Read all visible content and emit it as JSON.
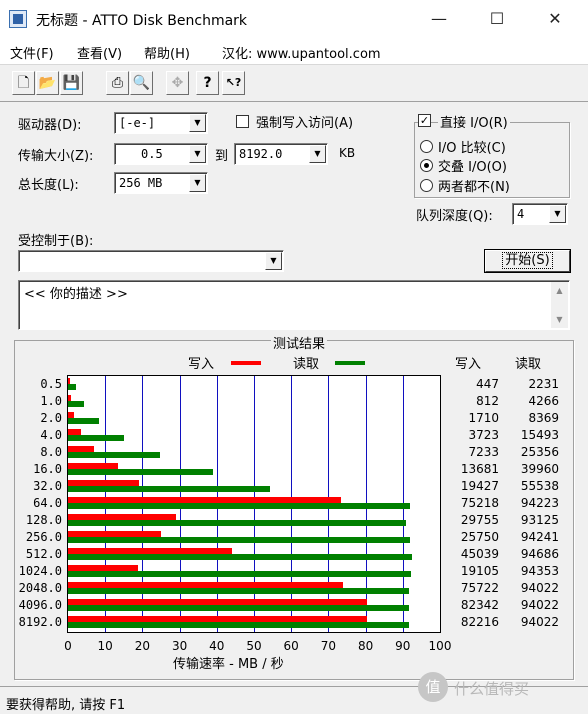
{
  "window": {
    "title": "无标题 - ATTO Disk Benchmark",
    "minimize_glyph": "—",
    "maximize_glyph": "☐",
    "close_glyph": "✕"
  },
  "menu": {
    "items": [
      "文件(F)",
      "查看(V)",
      "帮助(H)"
    ],
    "note": "汉化: www.upantool.com"
  },
  "toolbar": {
    "buttons": [
      {
        "icon": "new-file-icon",
        "glyph": "🗋"
      },
      {
        "icon": "open-folder-icon",
        "glyph": "📂"
      },
      {
        "icon": "save-icon",
        "glyph": "💾"
      },
      {
        "icon": "print-icon",
        "glyph": "⎙"
      },
      {
        "icon": "print-preview-icon",
        "glyph": "🔍"
      },
      {
        "icon": "move-icon",
        "glyph": "✥"
      },
      {
        "icon": "help-icon",
        "glyph": "?"
      },
      {
        "icon": "context-help-icon",
        "glyph": "↖?"
      }
    ]
  },
  "form": {
    "drive_label": "驱动器(D):",
    "drive_value": "[-e-]",
    "force_write_label": "强制写入访问(A)",
    "transfer_size_label": "传输大小(Z):",
    "transfer_from": "0.5",
    "to_label": "到",
    "transfer_to": "8192.0",
    "kb_label": "KB",
    "total_length_label": "总长度(L):",
    "total_length_value": "256 MB",
    "direct_io_label": "直接 I/O(R)",
    "direct_io_checked": "✓",
    "io_compare_label": "I/O 比较(C)",
    "overlapped_io_label": "交叠 I/O(O)",
    "neither_label": "两者都不(N)",
    "queue_depth_label": "队列深度(Q):",
    "queue_depth_value": "4",
    "controlled_by_label": "受控制于(B):",
    "controlled_by_value": "",
    "start_button": "开始(S)",
    "description": "<<  你的描述  >>"
  },
  "results": {
    "title": "测试结果",
    "legend_write": "写入",
    "legend_read": "读取",
    "col_write": "写入",
    "col_read": "读取",
    "write_color": "#ff0000",
    "read_color": "#008000"
  },
  "chart_data": {
    "type": "bar",
    "orientation": "horizontal",
    "title": "测试结果",
    "xlabel": "传输速率 - MB / 秒",
    "xlim": [
      0,
      100
    ],
    "xticks": [
      "0",
      "10",
      "20",
      "30",
      "40",
      "50",
      "60",
      "70",
      "80",
      "90",
      "100"
    ],
    "grid": true,
    "categories": [
      "0.5",
      "1.0",
      "2.0",
      "4.0",
      "8.0",
      "16.0",
      "32.0",
      "64.0",
      "128.0",
      "256.0",
      "512.0",
      "1024.0",
      "2048.0",
      "4096.0",
      "8192.0"
    ],
    "series": [
      {
        "name": "写入",
        "color": "#ff0000",
        "values": [
          0.4,
          0.8,
          1.7,
          3.6,
          7.1,
          13.4,
          19.0,
          73.5,
          29.1,
          25.1,
          44.0,
          18.7,
          73.9,
          80.4,
          80.3
        ]
      },
      {
        "name": "读取",
        "color": "#008000",
        "values": [
          2.2,
          4.2,
          8.2,
          15.1,
          24.8,
          39.0,
          54.2,
          92.0,
          90.9,
          92.0,
          92.5,
          92.1,
          91.8,
          91.8,
          91.8
        ]
      }
    ],
    "table": {
      "write": [
        "447",
        "812",
        "1710",
        "3723",
        "7233",
        "13681",
        "19427",
        "75218",
        "29755",
        "25750",
        "45039",
        "19105",
        "75722",
        "82342",
        "82216"
      ],
      "read": [
        "2231",
        "4266",
        "8369",
        "15493",
        "25356",
        "39960",
        "55538",
        "94223",
        "93125",
        "94241",
        "94686",
        "94353",
        "94022",
        "94022",
        "94022"
      ]
    }
  },
  "status": {
    "text": "要获得帮助, 请按 F1"
  },
  "watermark": {
    "logo_glyph": "值",
    "text": "什么值得买"
  }
}
